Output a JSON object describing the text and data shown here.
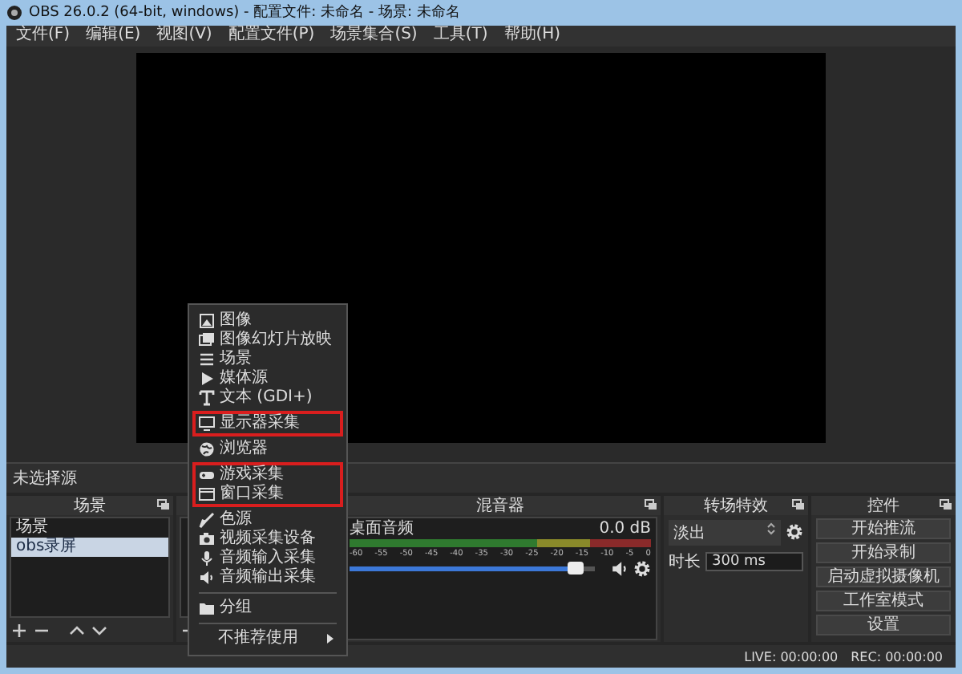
{
  "window": {
    "title": "OBS 26.0.2 (64-bit, windows) - 配置文件: 未命名 - 场景: 未命名"
  },
  "menu_bar": [
    "文件(F)",
    "编辑(E)",
    "视图(V)",
    "配置文件(P)",
    "场景集合(S)",
    "工具(T)",
    "帮助(H)"
  ],
  "source_bar": {
    "label": "未选择源"
  },
  "context_menu": {
    "sections": [
      {
        "outlined": false,
        "items": [
          {
            "kind": "item",
            "label": "图像"
          },
          {
            "kind": "item",
            "label": "图像幻灯片放映"
          },
          {
            "kind": "item",
            "label": "场景"
          },
          {
            "kind": "item",
            "label": "媒体源"
          },
          {
            "kind": "item",
            "label": "文本 (GDI+)"
          }
        ]
      },
      {
        "outlined": true,
        "items": [
          {
            "kind": "item",
            "label": "显示器采集"
          }
        ]
      },
      {
        "outlined": false,
        "items": [
          {
            "kind": "item",
            "label": "浏览器"
          }
        ]
      },
      {
        "outlined": true,
        "items": [
          {
            "kind": "item",
            "label": "游戏采集"
          },
          {
            "kind": "item",
            "label": "窗口采集"
          }
        ]
      },
      {
        "outlined": false,
        "items": [
          {
            "kind": "item",
            "label": "色源"
          },
          {
            "kind": "item",
            "label": "视频采集设备"
          },
          {
            "kind": "item",
            "label": "音频输入采集"
          },
          {
            "kind": "item",
            "label": "音频输出采集"
          },
          {
            "kind": "separator"
          },
          {
            "kind": "item",
            "label": "分组"
          },
          {
            "kind": "separator"
          },
          {
            "kind": "submenu",
            "label": "不推荐使用"
          }
        ]
      }
    ]
  },
  "scenes": {
    "title": "场景",
    "items": [
      {
        "label": "场景",
        "selected": false
      },
      {
        "label": "obs录屏",
        "selected": true
      }
    ]
  },
  "mixer": {
    "title": "混音器",
    "channel": {
      "name": "桌面音频",
      "reading": "0.0 dB",
      "level": 0.92,
      "ticks": [
        "-60",
        "-55",
        "-50",
        "-45",
        "-40",
        "-35",
        "-30",
        "-25",
        "-20",
        "-15",
        "-10",
        "-5",
        "0"
      ]
    }
  },
  "transitions": {
    "title": "转场特效",
    "transition": "淡出",
    "duration_label": "时长",
    "duration": "300 ms"
  },
  "controls": {
    "title": "控件",
    "buttons": [
      "开始推流",
      "开始录制",
      "启动虚拟摄像机",
      "工作室模式",
      "设置"
    ]
  },
  "status_bar": {
    "live": "LIVE: 00:00:00",
    "rec": "REC: 00:00:00"
  }
}
